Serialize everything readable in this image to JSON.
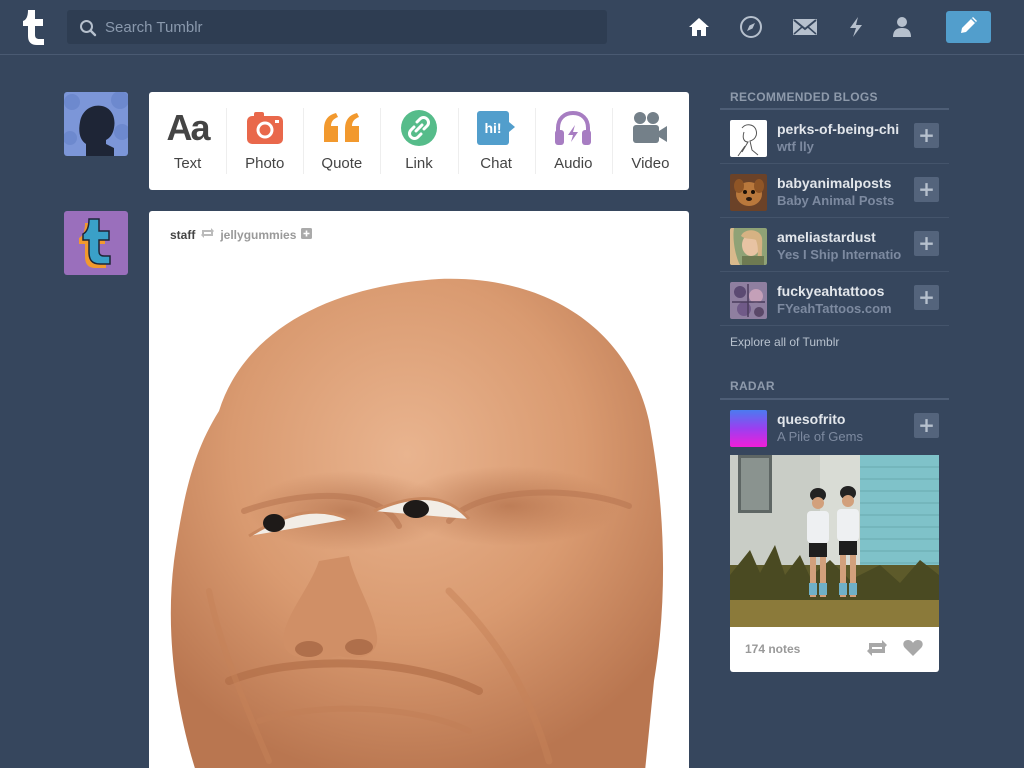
{
  "header": {
    "search_placeholder": "Search Tumblr"
  },
  "post_types": [
    {
      "label": "Text",
      "icon": "text-icon"
    },
    {
      "label": "Photo",
      "icon": "camera-icon"
    },
    {
      "label": "Quote",
      "icon": "quote-icon"
    },
    {
      "label": "Link",
      "icon": "link-icon"
    },
    {
      "label": "Chat",
      "icon": "chat-icon",
      "icon_text": "hi!"
    },
    {
      "label": "Audio",
      "icon": "headphones-icon"
    },
    {
      "label": "Video",
      "icon": "video-camera-icon"
    }
  ],
  "post": {
    "author": "staff",
    "reblogged_from": "jellygummies"
  },
  "sidebar": {
    "recommended_title": "RECOMMENDED BLOGS",
    "blogs": [
      {
        "name": "perks-of-being-chi",
        "subtitle": "wtf lly"
      },
      {
        "name": "babyanimalposts",
        "subtitle": "Baby Animal Posts"
      },
      {
        "name": "ameliastardust",
        "subtitle": "Yes I Ship Internatio"
      },
      {
        "name": "fuckyeahtattoos",
        "subtitle": "FYeahTattoos.com"
      }
    ],
    "explore_link": "Explore all of Tumblr",
    "radar_title": "RADAR",
    "radar": {
      "name": "quesofrito",
      "subtitle": "A Pile of Gems",
      "notes": "174 notes"
    }
  },
  "colors": {
    "background": "#36465d",
    "compose_button": "#529ecc",
    "photo_icon": "#e9684b",
    "quote_icon": "#f2992e",
    "link_icon": "#56bc8a",
    "chat_icon": "#529ecc",
    "audio_icon": "#a77dc2",
    "video_icon": "#748089"
  }
}
